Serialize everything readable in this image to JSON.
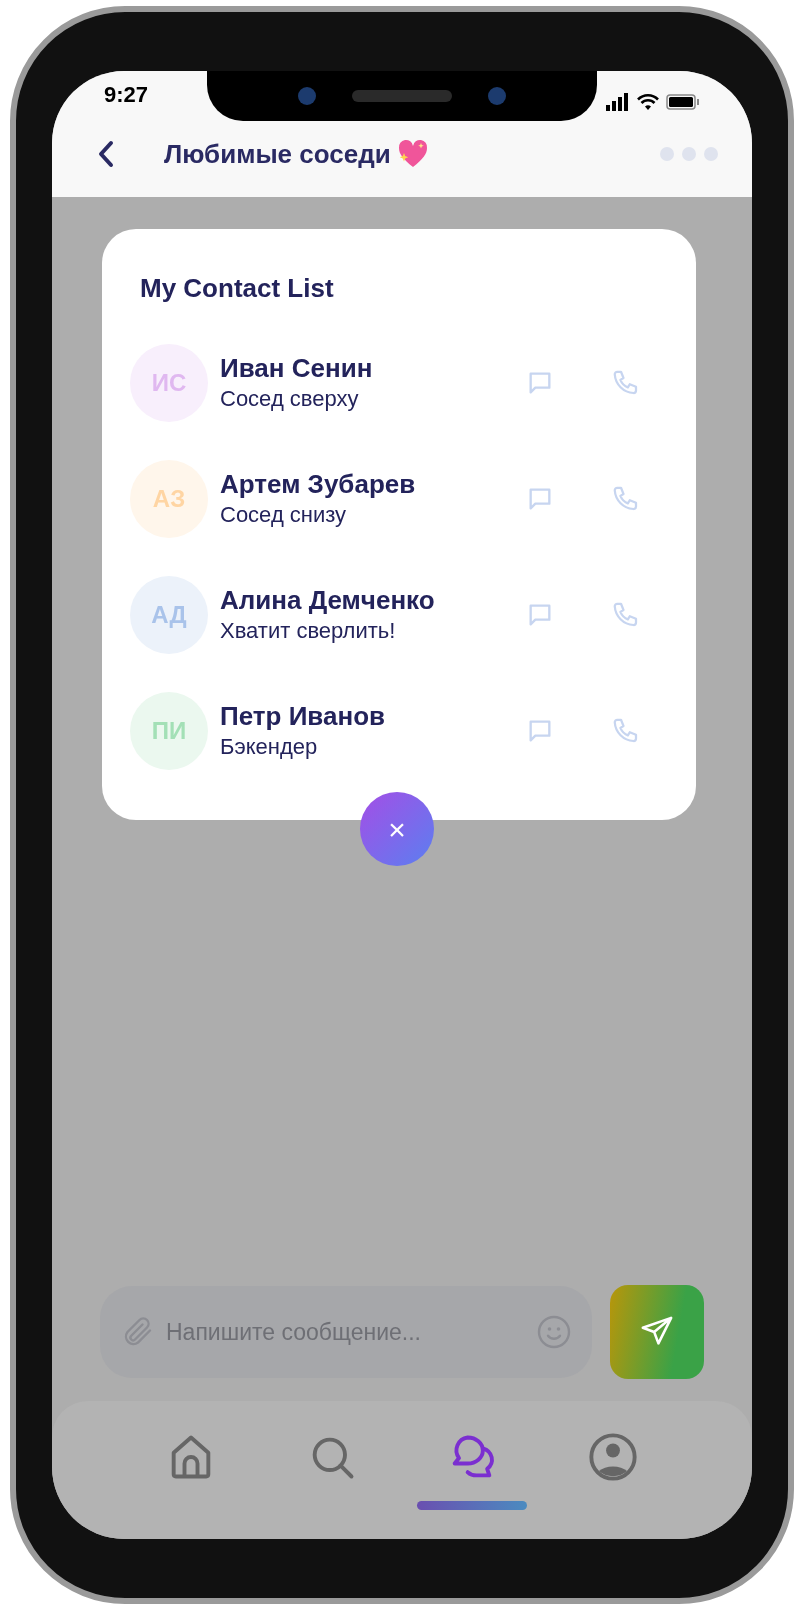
{
  "status_bar": {
    "time": "9:27"
  },
  "header": {
    "title": "Любимые соседи"
  },
  "contact_card": {
    "title": "My Contact List",
    "contacts": [
      {
        "initials": "ИС",
        "name": "Иван Сенин",
        "status": "Сосед сверху",
        "color": "#e0b8f0"
      },
      {
        "initials": "АЗ",
        "name": "Артем Зубарев",
        "status": "Сосед снизу",
        "color": "#ffd5a3"
      },
      {
        "initials": "АД",
        "name": "Алина Демченко",
        "status": "Хватит сверлить!",
        "color": "#a9c3ea"
      },
      {
        "initials": "ПИ",
        "name": "Петр Иванов",
        "status": "Бэкендер",
        "color": "#a3e0b6"
      }
    ]
  },
  "close_button": {
    "label": "×"
  },
  "composer": {
    "placeholder": "Напишите сообщение..."
  },
  "nav": [
    {
      "kind": "home",
      "selected": false
    },
    {
      "kind": "search",
      "selected": false
    },
    {
      "kind": "chat",
      "selected": true
    },
    {
      "kind": "profile",
      "selected": false
    }
  ]
}
